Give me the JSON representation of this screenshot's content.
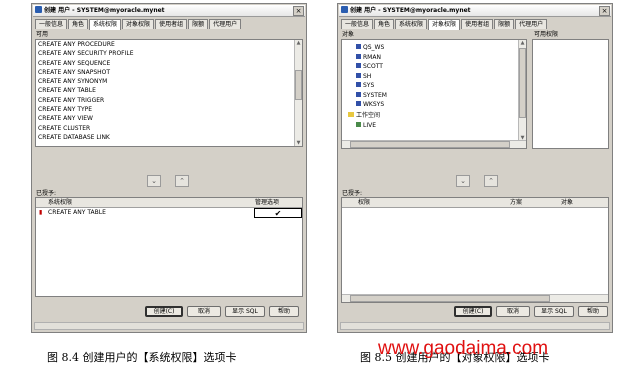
{
  "window1": {
    "title": "创建 用户 - SYSTEM@myoracle.mynet",
    "tabs": [
      "一般信息",
      "角色",
      "系统权限",
      "对象权限",
      "使用者组",
      "限额",
      "代理用户"
    ],
    "active_tab": "系统权限",
    "available_label": "可用",
    "available_privileges": [
      "CREATE ANY PROCEDURE",
      "CREATE ANY SECURITY PROFILE",
      "CREATE ANY SEQUENCE",
      "CREATE ANY SNAPSHOT",
      "CREATE ANY SYNONYM",
      "CREATE ANY TABLE",
      "CREATE ANY TRIGGER",
      "CREATE ANY TYPE",
      "CREATE ANY VIEW",
      "CREATE CLUSTER",
      "CREATE DATABASE LINK"
    ],
    "granted_label": "已授予:",
    "grid_headers": {
      "privilege": "系统权限",
      "admin_option": "管理选项"
    },
    "granted_rows": [
      {
        "privilege": "CREATE ANY TABLE",
        "admin_option": "✔"
      }
    ],
    "buttons": {
      "create": "创建(C)",
      "cancel": "取消",
      "show_sql": "显示 SQL",
      "help": "帮助"
    }
  },
  "window2": {
    "title": "创建 用户 - SYSTEM@myoracle.mynet",
    "tabs": [
      "一般信息",
      "角色",
      "系统权限",
      "对象权限",
      "使用者组",
      "限额",
      "代理用户"
    ],
    "active_tab": "对象权限",
    "objects_label": "对象",
    "available_privs_label": "可用权限",
    "tree_items": [
      "QS_WS",
      "RMAN",
      "SCOTT",
      "SH",
      "SYS",
      "SYSTEM",
      "WKSYS"
    ],
    "tree_folder": "工作空间",
    "tree_child": "LIVE",
    "granted_label": "已授予:",
    "grid_headers": {
      "privilege": "权限",
      "schema": "方案",
      "object": "对象"
    },
    "buttons": {
      "create": "创建(C)",
      "cancel": "取消",
      "show_sql": "显示 SQL",
      "help": "帮助"
    }
  },
  "captions": {
    "left": "图 8.4   创建用户的【系统权限】选项卡",
    "right": "图 8.5   创建用户的【对象权限】选项卡"
  },
  "watermark": "www.gaodaima.com"
}
